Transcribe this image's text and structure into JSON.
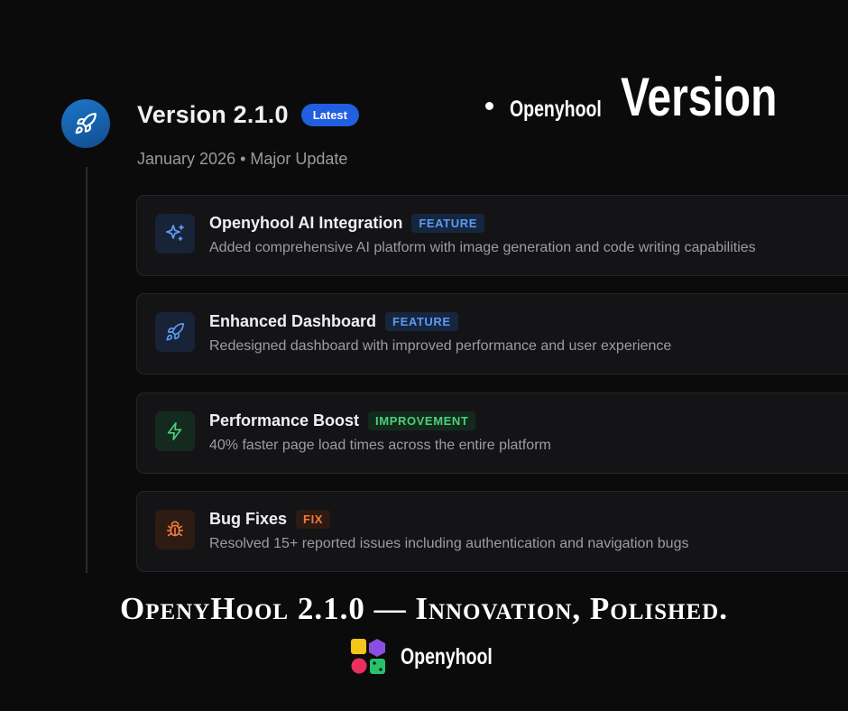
{
  "version": {
    "title": "Version 2.1.0",
    "badge": "Latest",
    "subtitle": "January 2026 • Major Update",
    "icon": "rocket-icon",
    "accent": "#1f5fe0"
  },
  "brand_heading": {
    "small": "Openyhool",
    "big": "Version"
  },
  "updates": [
    {
      "title": "Openyhool AI Integration",
      "tag": "FEATURE",
      "description": "Added comprehensive AI platform with image generation and code writing capabilities",
      "icon": "sparkles-icon",
      "color": "#5b9bf0"
    },
    {
      "title": "Enhanced Dashboard",
      "tag": "FEATURE",
      "description": "Redesigned dashboard with improved performance and user experience",
      "icon": "rocket-icon",
      "color": "#5b9bf0"
    },
    {
      "title": "Performance Boost",
      "tag": "IMPROVEMENT",
      "description": "40% faster page load times across the entire platform",
      "icon": "lightning-icon",
      "color": "#4ccf7c"
    },
    {
      "title": "Bug Fixes",
      "tag": "FIX",
      "description": "Resolved 15+ reported issues including authentication and navigation bugs",
      "icon": "bug-icon",
      "color": "#ef7c3a"
    }
  ],
  "tagline": "OpenyHool 2.1.0 — Innovation, Polished.",
  "footer": {
    "brand": "Openyhool",
    "logo": "openyhool-logo-icon"
  }
}
